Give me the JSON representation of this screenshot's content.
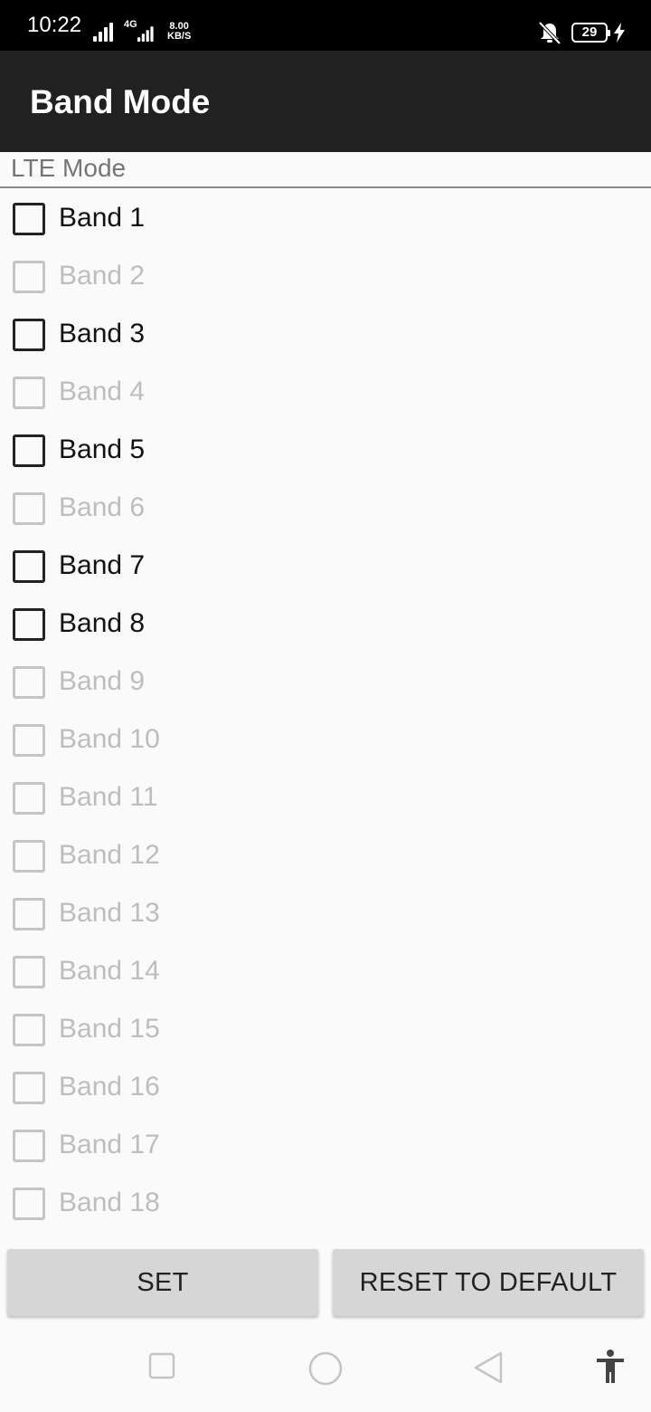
{
  "status_bar": {
    "time": "10:22",
    "network_type": "4G",
    "speed_value": "8.00",
    "speed_unit": "KB/S",
    "battery": "29",
    "icons": [
      "signal-icon",
      "mobile-data-icon",
      "mute-icon",
      "battery-icon",
      "charging-icon"
    ]
  },
  "app_bar": {
    "title": "Band Mode"
  },
  "section": {
    "label": "LTE Mode"
  },
  "bands": [
    {
      "label": "Band 1",
      "enabled": true,
      "checked": false
    },
    {
      "label": "Band 2",
      "enabled": false,
      "checked": false
    },
    {
      "label": "Band 3",
      "enabled": true,
      "checked": false
    },
    {
      "label": "Band 4",
      "enabled": false,
      "checked": false
    },
    {
      "label": "Band 5",
      "enabled": true,
      "checked": false
    },
    {
      "label": "Band 6",
      "enabled": false,
      "checked": false
    },
    {
      "label": "Band 7",
      "enabled": true,
      "checked": false
    },
    {
      "label": "Band 8",
      "enabled": true,
      "checked": false
    },
    {
      "label": "Band 9",
      "enabled": false,
      "checked": false
    },
    {
      "label": "Band 10",
      "enabled": false,
      "checked": false
    },
    {
      "label": "Band 11",
      "enabled": false,
      "checked": false
    },
    {
      "label": "Band 12",
      "enabled": false,
      "checked": false
    },
    {
      "label": "Band 13",
      "enabled": false,
      "checked": false
    },
    {
      "label": "Band 14",
      "enabled": false,
      "checked": false
    },
    {
      "label": "Band 15",
      "enabled": false,
      "checked": false
    },
    {
      "label": "Band 16",
      "enabled": false,
      "checked": false
    },
    {
      "label": "Band 17",
      "enabled": false,
      "checked": false
    },
    {
      "label": "Band 18",
      "enabled": false,
      "checked": false
    }
  ],
  "buttons": {
    "set_label": "SET",
    "reset_label": "RESET TO DEFAULT"
  },
  "nav_bar": {
    "icons": [
      "recents-square-icon",
      "home-circle-icon",
      "back-triangle-icon",
      "accessibility-icon"
    ]
  },
  "colors": {
    "status_bar": "#000000",
    "app_bar": "#212121",
    "background": "#fafafa",
    "button": "#d6d6d6",
    "disabled": "#bdbdbd"
  }
}
